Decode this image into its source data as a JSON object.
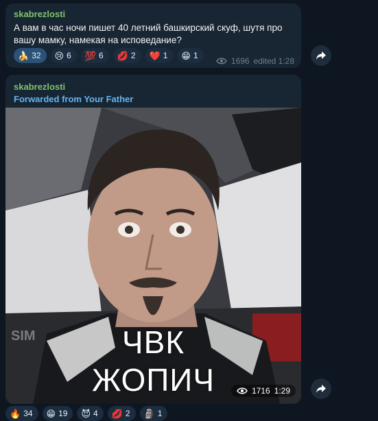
{
  "messages": [
    {
      "author": "skabrezlosti",
      "text": "А вам в час ночи пишет 40 летний башкирский скуф, шутя про вашу мамку, намекая на исповедание?",
      "reactions": [
        {
          "emoji": "🍌",
          "count": "32",
          "active": true
        },
        {
          "emoji": "😢",
          "count": "6",
          "active": false
        },
        {
          "emoji": "💯",
          "count": "6",
          "active": false
        },
        {
          "emoji": "💋",
          "count": "2",
          "active": false
        },
        {
          "emoji": "❤️",
          "count": "1",
          "active": false
        },
        {
          "emoji": "😁",
          "count": "1",
          "active": false
        }
      ],
      "views": "1696",
      "status": "edited 1:28"
    },
    {
      "author": "skabrezlosti",
      "forwarded": "Forwarded from Your Father",
      "video": {
        "caption_line1": "ЧВК",
        "caption_line2": "ЖОПИЧ",
        "jersey_text": "SIM"
      },
      "views": "1716",
      "time": "1:29",
      "reactions": [
        {
          "emoji": "🔥",
          "count": "34"
        },
        {
          "emoji": "😁",
          "count": "19"
        },
        {
          "emoji": "😈",
          "count": "4"
        },
        {
          "emoji": "💋",
          "count": "2"
        },
        {
          "emoji": "🗿",
          "count": "1"
        }
      ]
    }
  ],
  "icons": {
    "share": "share-arrow-icon",
    "views": "eye-icon"
  },
  "colors": {
    "background": "#0e1621",
    "bubble": "#182533",
    "author": "#7ec46d",
    "forward": "#64b5ef",
    "reaction_active": "#2b5278"
  }
}
